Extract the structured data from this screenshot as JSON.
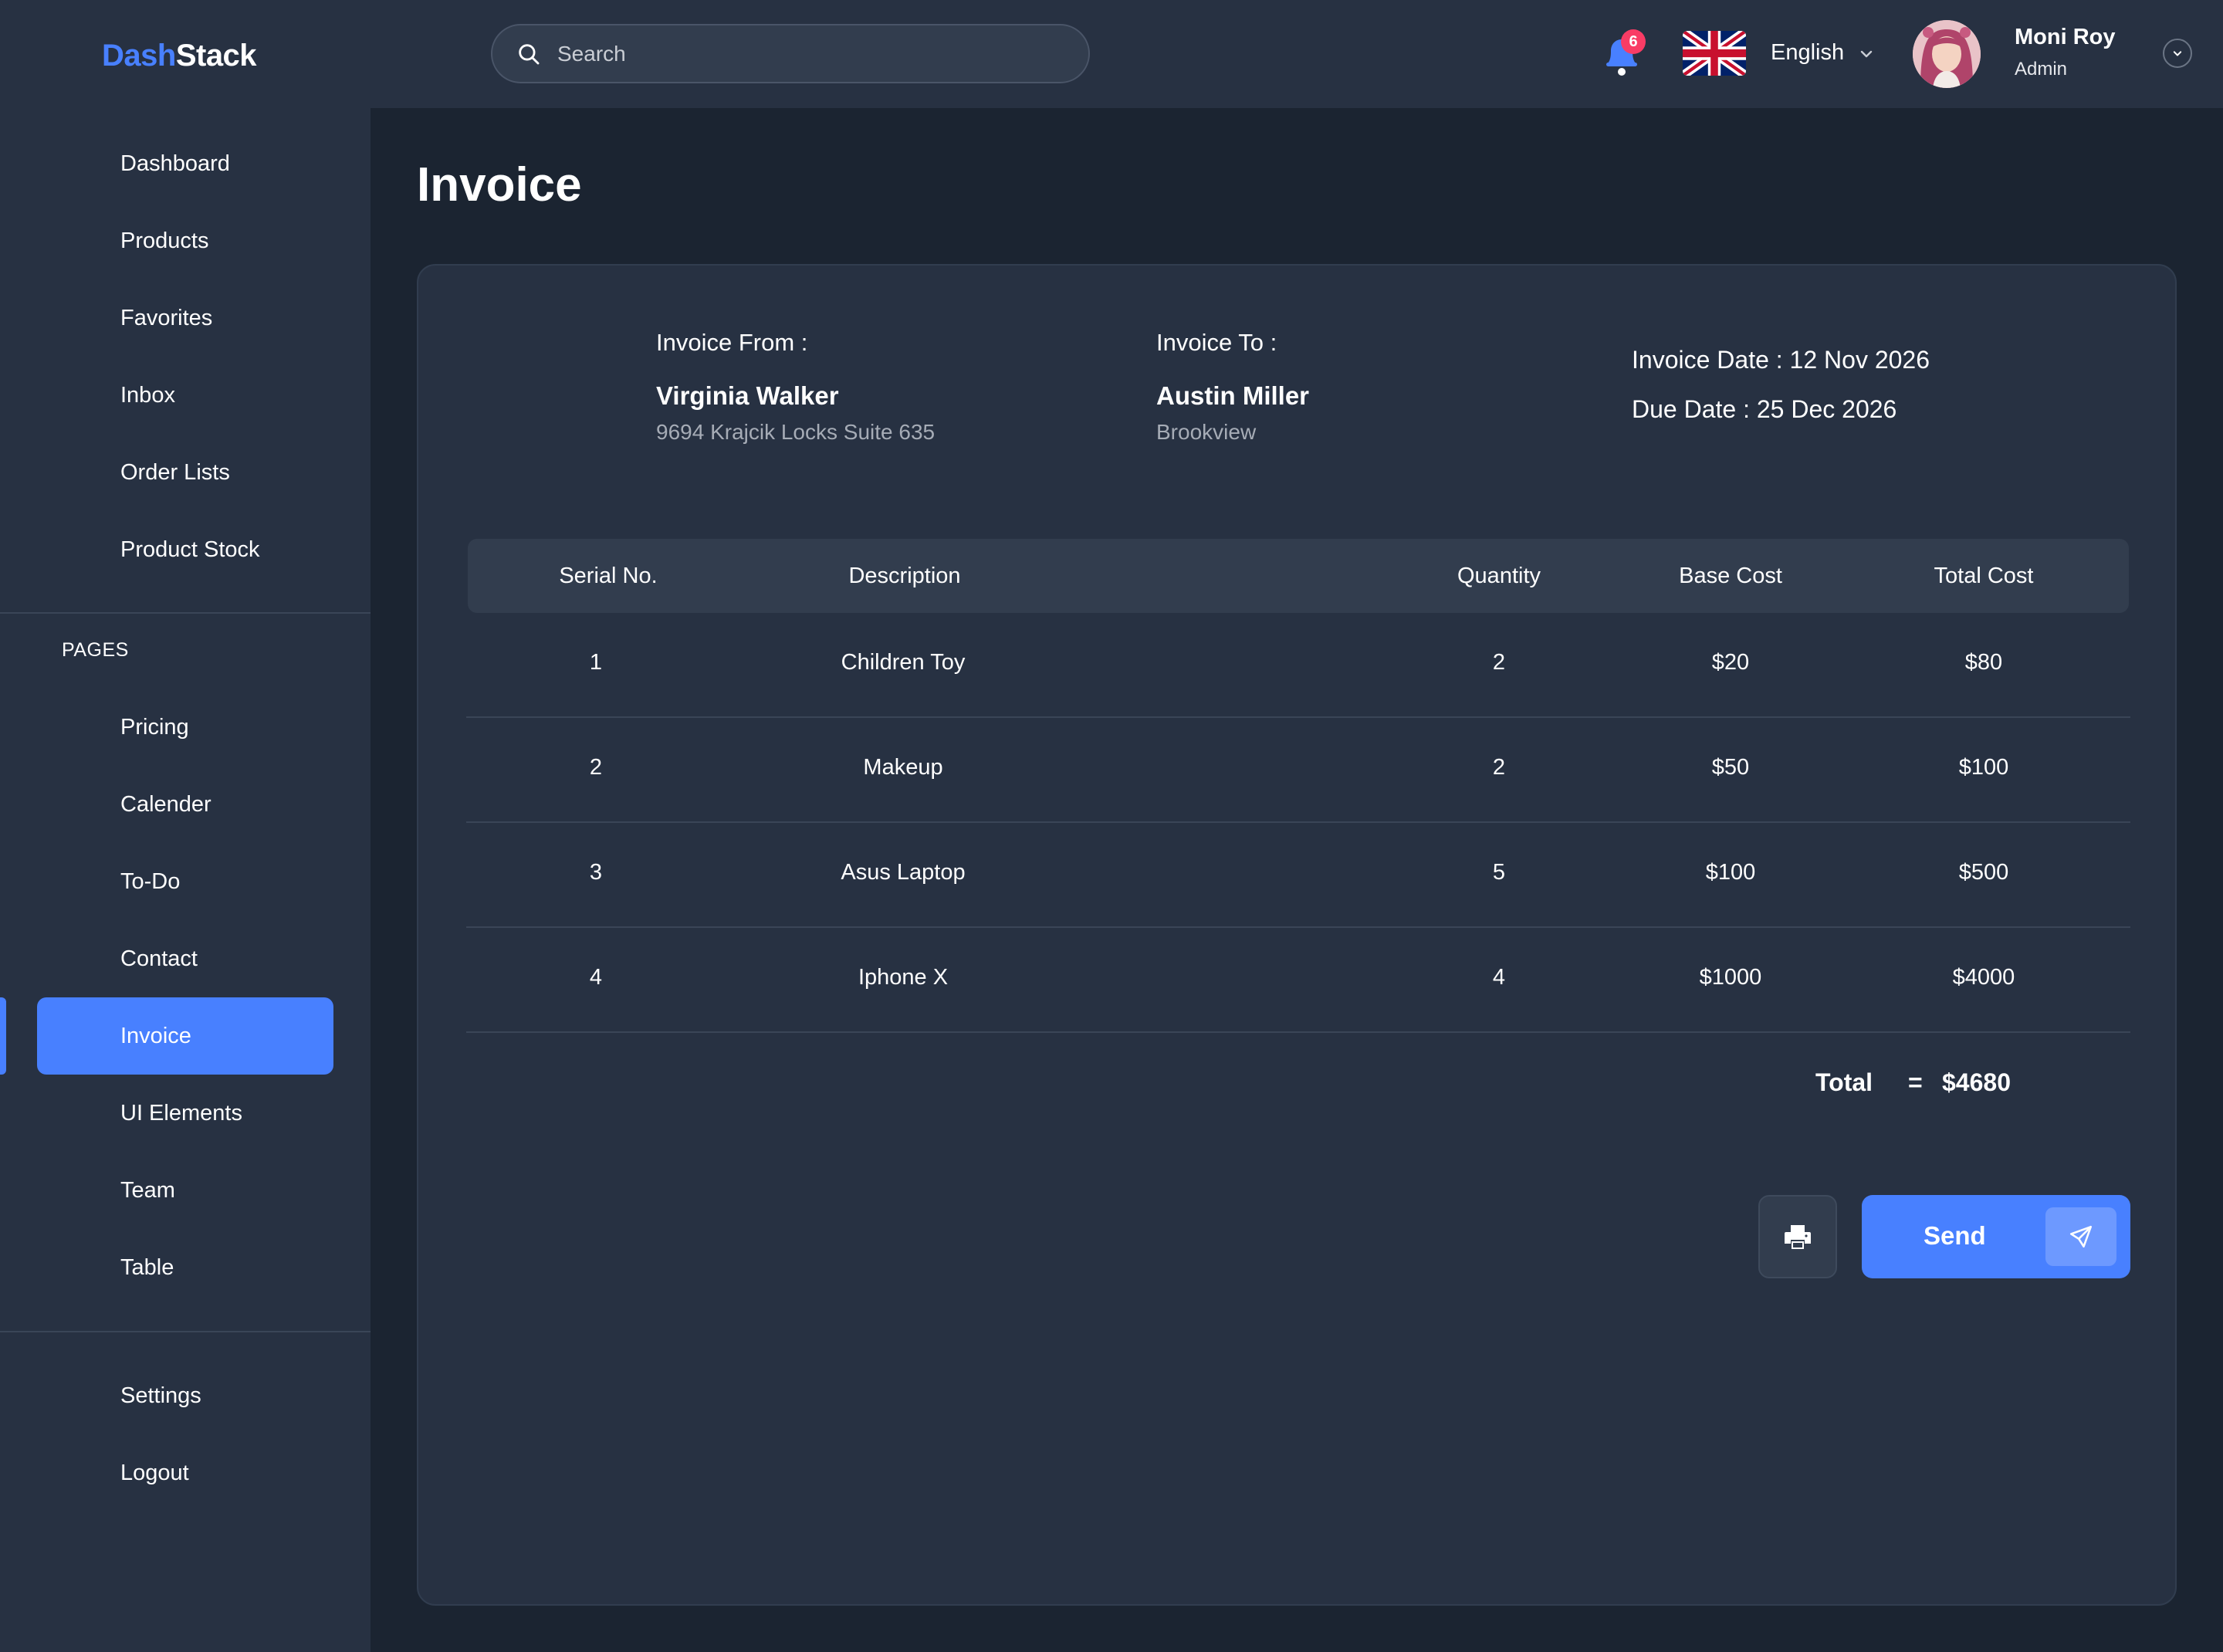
{
  "brand": {
    "part1": "Dash",
    "part2": "Stack"
  },
  "sidebar": {
    "main_items": [
      {
        "label": "Dashboard"
      },
      {
        "label": "Products"
      },
      {
        "label": "Favorites"
      },
      {
        "label": "Inbox"
      },
      {
        "label": "Order Lists"
      },
      {
        "label": "Product Stock"
      }
    ],
    "section_title": "PAGES",
    "page_items": [
      {
        "label": "Pricing"
      },
      {
        "label": "Calender"
      },
      {
        "label": "To-Do"
      },
      {
        "label": "Contact"
      },
      {
        "label": "Invoice"
      },
      {
        "label": "UI Elements"
      },
      {
        "label": "Team"
      },
      {
        "label": "Table"
      }
    ],
    "active_item": "Invoice",
    "bottom_items": [
      {
        "label": "Settings"
      },
      {
        "label": "Logout"
      }
    ]
  },
  "header": {
    "search_placeholder": "Search",
    "notification_count": "6",
    "language": "English",
    "user": {
      "name": "Moni Roy",
      "role": "Admin"
    }
  },
  "page": {
    "title": "Invoice"
  },
  "invoice": {
    "from": {
      "label": "Invoice From :",
      "name": "Virginia Walker",
      "address": "9694 Krajcik Locks Suite 635"
    },
    "to": {
      "label": "Invoice To :",
      "name": "Austin Miller",
      "address": "Brookview"
    },
    "invoice_date": "Invoice Date : 12 Nov 2026",
    "due_date": "Due Date : 25 Dec 2026",
    "columns": [
      "Serial No.",
      "Description",
      "Quantity",
      "Base Cost",
      "Total Cost"
    ],
    "rows": [
      {
        "serial": "1",
        "description": "Children Toy",
        "quantity": "2",
        "base_cost": "$20",
        "total_cost": "$80"
      },
      {
        "serial": "2",
        "description": "Makeup",
        "quantity": "2",
        "base_cost": "$50",
        "total_cost": "$100"
      },
      {
        "serial": "3",
        "description": "Asus Laptop",
        "quantity": "5",
        "base_cost": "$100",
        "total_cost": "$500"
      },
      {
        "serial": "4",
        "description": "Iphone X",
        "quantity": "4",
        "base_cost": "$1000",
        "total_cost": "$4000"
      }
    ],
    "total_label": "Total",
    "total_equals": "=",
    "total_value": "$4680",
    "send_label": "Send"
  },
  "colors": {
    "accent": "#4880ff",
    "background": "#1b2431",
    "surface": "#273142",
    "badge": "#f93c65"
  },
  "icons": {
    "search": "search-icon",
    "notification": "bell-icon",
    "flag": "uk-flag-icon",
    "chevron": "chevron-down-icon",
    "print": "printer-icon",
    "send": "paper-plane-icon"
  }
}
